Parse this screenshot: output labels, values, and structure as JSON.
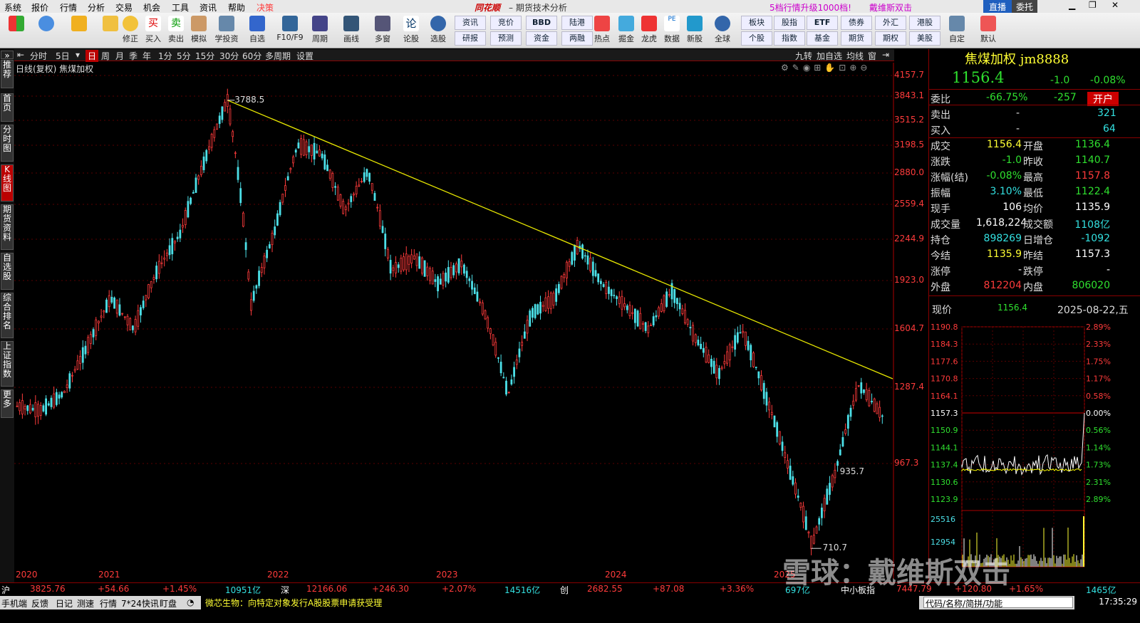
{
  "menu": [
    "系统",
    "报价",
    "行情",
    "分析",
    "交易",
    "机会",
    "工具",
    "资讯",
    "帮助",
    "决策"
  ],
  "app": {
    "brand": "同花顺",
    "title": "期货技术分析",
    "promo": "5档行情升级1000档!",
    "user": "戴维斯双击",
    "live": "直播",
    "commission": "委托"
  },
  "toolbar": [
    "修正",
    "买入",
    "卖出",
    "模拟",
    "学投资",
    "自选",
    "F10/F9",
    "周期",
    "画线",
    "多窗",
    "论股",
    "选股",
    "热点",
    "掘金",
    "龙虎",
    "数据",
    "新股",
    "全球",
    "自定",
    "默认"
  ],
  "toolbar_small": [
    [
      "资讯",
      "竞价",
      "BBD",
      "陆港",
      "板块",
      "股指",
      "ETF",
      "债券",
      "外汇",
      "港股"
    ],
    [
      "研报",
      "预测",
      "资金",
      "两融",
      "个股",
      "指数",
      "基金",
      "期货",
      "期权",
      "美股"
    ]
  ],
  "periods": [
    "分时",
    "5日",
    "日",
    "周",
    "月",
    "季",
    "年",
    "1分",
    "5分",
    "15分",
    "30分",
    "60分",
    "多周期",
    "设置"
  ],
  "period_right": [
    "九转",
    "加自选",
    "均线",
    "窗"
  ],
  "leftnav": [
    "推荐",
    "首页",
    "分时图",
    "K线图",
    "期货资料",
    "自选股",
    "综合排名",
    "上证指数",
    "更多"
  ],
  "chart": {
    "subtitle": "日线(复权) 焦煤加权",
    "price_axis": [
      "4157.7",
      "3843.1",
      "3515.2",
      "3198.5",
      "2880.0",
      "2559.4",
      "2244.9",
      "1923.0",
      "1604.7",
      "1287.4",
      "967.3"
    ],
    "years": [
      "2020",
      "2021",
      "2022",
      "2023",
      "2024",
      "2025"
    ],
    "high_label": "3788.5",
    "low_label": "710.7",
    "mid_label": "935.7"
  },
  "chart_data": {
    "type": "candlestick",
    "title": "焦煤加权",
    "x_range": [
      "2020",
      "2025"
    ],
    "ylim": [
      700,
      4160
    ],
    "high": 3788.5,
    "low": 710.7,
    "series": [
      {
        "name": "日K",
        "approx_close": [
          1200,
          1180,
          1260,
          1500,
          1800,
          1600,
          2000,
          2300,
          3000,
          3788.5,
          1750,
          2300,
          3200,
          3100,
          2500,
          2900,
          2000,
          2100,
          1900,
          2050,
          1700,
          1250,
          1700,
          1800,
          2200,
          1900,
          1750,
          1600,
          1850,
          1550,
          1350,
          1600,
          1250,
          950,
          710.7,
          935.7,
          1300,
          1156.4
        ]
      }
    ]
  },
  "quote": {
    "name": "焦煤加权",
    "code": "jm8888",
    "price": "1156.4",
    "chg": "-1.0",
    "pct": "-0.08%",
    "weibi_label": "委比",
    "weibi": "-66.75%",
    "weibi2": "-257",
    "open_tag": "开户",
    "sell_label": "卖出",
    "sell": "-",
    "sell_vol": "321",
    "buy_label": "买入",
    "buy": "-",
    "buy_vol": "64",
    "rows": [
      [
        "成交",
        "1156.4",
        "开盘",
        "1136.4"
      ],
      [
        "涨跌",
        "-1.0",
        "昨收",
        "1140.7"
      ],
      [
        "涨幅(结)",
        "-0.08%",
        "最高",
        "1157.8"
      ],
      [
        "振幅",
        "3.10%",
        "最低",
        "1122.4"
      ],
      [
        "现手",
        "106",
        "均价",
        "1135.9"
      ],
      [
        "成交量",
        "1,618,224",
        "成交额",
        "1108亿"
      ],
      [
        "持仓",
        "898269",
        "日增仓",
        "-1092"
      ],
      [
        "今结",
        "1135.9",
        "昨结",
        "1157.3"
      ],
      [
        "涨停",
        "-",
        "跌停",
        "-"
      ],
      [
        "外盘",
        "812204",
        "内盘",
        "806020"
      ]
    ]
  },
  "mini": {
    "label": "现价",
    "price": "1156.4",
    "date": "2025-08-22,五",
    "left_axis": [
      "1190.8",
      "1184.3",
      "1177.6",
      "1170.8",
      "1164.1",
      "1157.3",
      "1150.9",
      "1144.1",
      "1137.4",
      "1130.6",
      "1123.9"
    ],
    "right_axis": [
      "2.89%",
      "2.33%",
      "1.75%",
      "1.17%",
      "0.58%",
      "0.00%",
      "0.56%",
      "1.14%",
      "1.73%",
      "2.31%",
      "2.89%"
    ],
    "vol_axis": [
      "25516",
      "12954"
    ]
  },
  "status": [
    [
      "沪",
      "3825.76",
      "+54.66",
      "+1.45%",
      "10951亿"
    ],
    [
      "深",
      "12166.06",
      "+246.30",
      "+2.07%",
      "14516亿"
    ],
    [
      "创",
      "2682.55",
      "+87.08",
      "+3.36%",
      "697亿"
    ],
    [
      "中小板指",
      "7447.79",
      "+120.80",
      "+1.65%",
      "1465亿"
    ]
  ],
  "bottom": [
    "手机端",
    "反馈",
    "日记",
    "测速",
    "行情",
    "7*24快讯",
    "盯盘"
  ],
  "news": "微芯生物：向特定对象发行A股股票申请获受理",
  "bottom_right": "代码/名称/简拼/功能",
  "clock": "17:35:29",
  "watermark": "雪球：戴维斯双击"
}
